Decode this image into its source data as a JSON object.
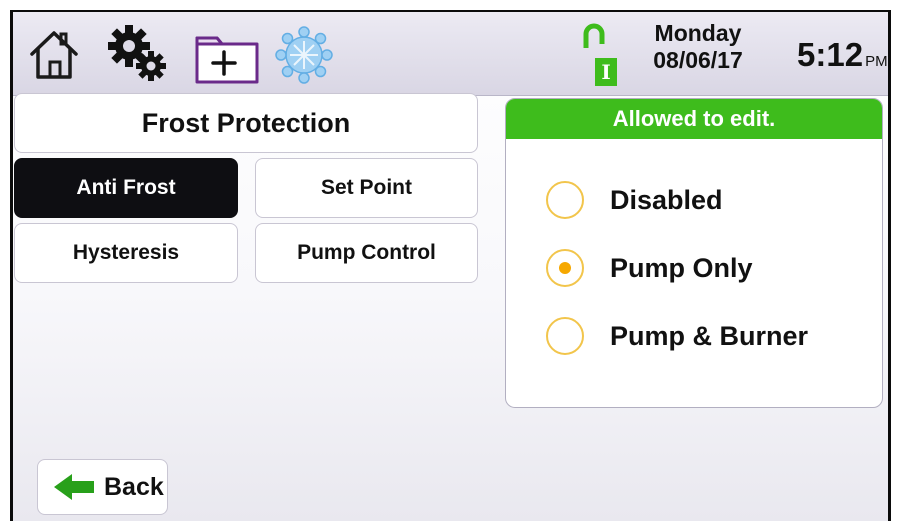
{
  "status": {
    "day": "Monday",
    "date": "08/06/17",
    "time": "5:12",
    "ampm": "PM",
    "lock_label": "I"
  },
  "page_title": "Frost Protection",
  "tabs": [
    {
      "label": "Anti Frost",
      "active": true
    },
    {
      "label": "Set Point",
      "active": false
    },
    {
      "label": "Hysteresis",
      "active": false
    },
    {
      "label": "Pump Control",
      "active": false
    }
  ],
  "panel": {
    "header": "Allowed to edit.",
    "options": [
      {
        "label": "Disabled",
        "selected": false
      },
      {
        "label": "Pump Only",
        "selected": true
      },
      {
        "label": "Pump & Burner",
        "selected": false
      }
    ]
  },
  "back_button": {
    "label": "Back"
  },
  "icons": [
    "home-icon",
    "settings-gears-icon",
    "add-folder-icon",
    "snowflake-icon",
    "unlocked-padlock-icon",
    "back-arrow-icon"
  ],
  "colors": {
    "accent_green": "#3ebc1c",
    "radio_border": "#f2c54b",
    "radio_selected": "#f6a800",
    "active_tab": "#0e0e12"
  }
}
